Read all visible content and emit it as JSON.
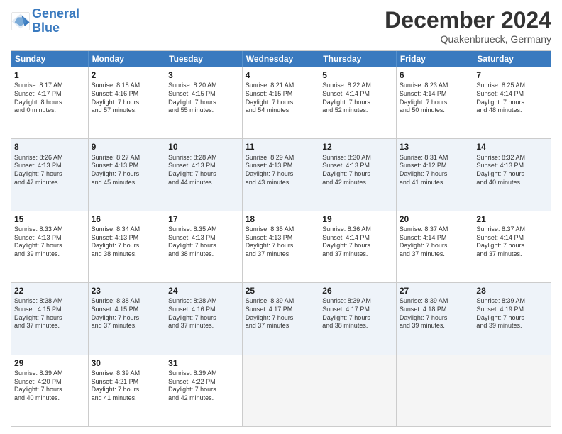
{
  "header": {
    "logo_line1": "General",
    "logo_line2": "Blue",
    "month": "December 2024",
    "location": "Quakenbrueck, Germany"
  },
  "days_of_week": [
    "Sunday",
    "Monday",
    "Tuesday",
    "Wednesday",
    "Thursday",
    "Friday",
    "Saturday"
  ],
  "rows": [
    [
      {
        "day": "1",
        "lines": [
          "Sunrise: 8:17 AM",
          "Sunset: 4:17 PM",
          "Daylight: 8 hours",
          "and 0 minutes."
        ],
        "alt": false
      },
      {
        "day": "2",
        "lines": [
          "Sunrise: 8:18 AM",
          "Sunset: 4:16 PM",
          "Daylight: 7 hours",
          "and 57 minutes."
        ],
        "alt": false
      },
      {
        "day": "3",
        "lines": [
          "Sunrise: 8:20 AM",
          "Sunset: 4:15 PM",
          "Daylight: 7 hours",
          "and 55 minutes."
        ],
        "alt": false
      },
      {
        "day": "4",
        "lines": [
          "Sunrise: 8:21 AM",
          "Sunset: 4:15 PM",
          "Daylight: 7 hours",
          "and 54 minutes."
        ],
        "alt": false
      },
      {
        "day": "5",
        "lines": [
          "Sunrise: 8:22 AM",
          "Sunset: 4:14 PM",
          "Daylight: 7 hours",
          "and 52 minutes."
        ],
        "alt": false
      },
      {
        "day": "6",
        "lines": [
          "Sunrise: 8:23 AM",
          "Sunset: 4:14 PM",
          "Daylight: 7 hours",
          "and 50 minutes."
        ],
        "alt": false
      },
      {
        "day": "7",
        "lines": [
          "Sunrise: 8:25 AM",
          "Sunset: 4:14 PM",
          "Daylight: 7 hours",
          "and 48 minutes."
        ],
        "alt": false
      }
    ],
    [
      {
        "day": "8",
        "lines": [
          "Sunrise: 8:26 AM",
          "Sunset: 4:13 PM",
          "Daylight: 7 hours",
          "and 47 minutes."
        ],
        "alt": true
      },
      {
        "day": "9",
        "lines": [
          "Sunrise: 8:27 AM",
          "Sunset: 4:13 PM",
          "Daylight: 7 hours",
          "and 45 minutes."
        ],
        "alt": true
      },
      {
        "day": "10",
        "lines": [
          "Sunrise: 8:28 AM",
          "Sunset: 4:13 PM",
          "Daylight: 7 hours",
          "and 44 minutes."
        ],
        "alt": true
      },
      {
        "day": "11",
        "lines": [
          "Sunrise: 8:29 AM",
          "Sunset: 4:13 PM",
          "Daylight: 7 hours",
          "and 43 minutes."
        ],
        "alt": true
      },
      {
        "day": "12",
        "lines": [
          "Sunrise: 8:30 AM",
          "Sunset: 4:13 PM",
          "Daylight: 7 hours",
          "and 42 minutes."
        ],
        "alt": true
      },
      {
        "day": "13",
        "lines": [
          "Sunrise: 8:31 AM",
          "Sunset: 4:12 PM",
          "Daylight: 7 hours",
          "and 41 minutes."
        ],
        "alt": true
      },
      {
        "day": "14",
        "lines": [
          "Sunrise: 8:32 AM",
          "Sunset: 4:13 PM",
          "Daylight: 7 hours",
          "and 40 minutes."
        ],
        "alt": true
      }
    ],
    [
      {
        "day": "15",
        "lines": [
          "Sunrise: 8:33 AM",
          "Sunset: 4:13 PM",
          "Daylight: 7 hours",
          "and 39 minutes."
        ],
        "alt": false
      },
      {
        "day": "16",
        "lines": [
          "Sunrise: 8:34 AM",
          "Sunset: 4:13 PM",
          "Daylight: 7 hours",
          "and 38 minutes."
        ],
        "alt": false
      },
      {
        "day": "17",
        "lines": [
          "Sunrise: 8:35 AM",
          "Sunset: 4:13 PM",
          "Daylight: 7 hours",
          "and 38 minutes."
        ],
        "alt": false
      },
      {
        "day": "18",
        "lines": [
          "Sunrise: 8:35 AM",
          "Sunset: 4:13 PM",
          "Daylight: 7 hours",
          "and 37 minutes."
        ],
        "alt": false
      },
      {
        "day": "19",
        "lines": [
          "Sunrise: 8:36 AM",
          "Sunset: 4:14 PM",
          "Daylight: 7 hours",
          "and 37 minutes."
        ],
        "alt": false
      },
      {
        "day": "20",
        "lines": [
          "Sunrise: 8:37 AM",
          "Sunset: 4:14 PM",
          "Daylight: 7 hours",
          "and 37 minutes."
        ],
        "alt": false
      },
      {
        "day": "21",
        "lines": [
          "Sunrise: 8:37 AM",
          "Sunset: 4:14 PM",
          "Daylight: 7 hours",
          "and 37 minutes."
        ],
        "alt": false
      }
    ],
    [
      {
        "day": "22",
        "lines": [
          "Sunrise: 8:38 AM",
          "Sunset: 4:15 PM",
          "Daylight: 7 hours",
          "and 37 minutes."
        ],
        "alt": true
      },
      {
        "day": "23",
        "lines": [
          "Sunrise: 8:38 AM",
          "Sunset: 4:15 PM",
          "Daylight: 7 hours",
          "and 37 minutes."
        ],
        "alt": true
      },
      {
        "day": "24",
        "lines": [
          "Sunrise: 8:38 AM",
          "Sunset: 4:16 PM",
          "Daylight: 7 hours",
          "and 37 minutes."
        ],
        "alt": true
      },
      {
        "day": "25",
        "lines": [
          "Sunrise: 8:39 AM",
          "Sunset: 4:17 PM",
          "Daylight: 7 hours",
          "and 37 minutes."
        ],
        "alt": true
      },
      {
        "day": "26",
        "lines": [
          "Sunrise: 8:39 AM",
          "Sunset: 4:17 PM",
          "Daylight: 7 hours",
          "and 38 minutes."
        ],
        "alt": true
      },
      {
        "day": "27",
        "lines": [
          "Sunrise: 8:39 AM",
          "Sunset: 4:18 PM",
          "Daylight: 7 hours",
          "and 39 minutes."
        ],
        "alt": true
      },
      {
        "day": "28",
        "lines": [
          "Sunrise: 8:39 AM",
          "Sunset: 4:19 PM",
          "Daylight: 7 hours",
          "and 39 minutes."
        ],
        "alt": true
      }
    ],
    [
      {
        "day": "29",
        "lines": [
          "Sunrise: 8:39 AM",
          "Sunset: 4:20 PM",
          "Daylight: 7 hours",
          "and 40 minutes."
        ],
        "alt": false
      },
      {
        "day": "30",
        "lines": [
          "Sunrise: 8:39 AM",
          "Sunset: 4:21 PM",
          "Daylight: 7 hours",
          "and 41 minutes."
        ],
        "alt": false
      },
      {
        "day": "31",
        "lines": [
          "Sunrise: 8:39 AM",
          "Sunset: 4:22 PM",
          "Daylight: 7 hours",
          "and 42 minutes."
        ],
        "alt": false
      },
      {
        "day": "",
        "lines": [],
        "empty": true,
        "alt": false
      },
      {
        "day": "",
        "lines": [],
        "empty": true,
        "alt": false
      },
      {
        "day": "",
        "lines": [],
        "empty": true,
        "alt": false
      },
      {
        "day": "",
        "lines": [],
        "empty": true,
        "alt": false
      }
    ]
  ]
}
